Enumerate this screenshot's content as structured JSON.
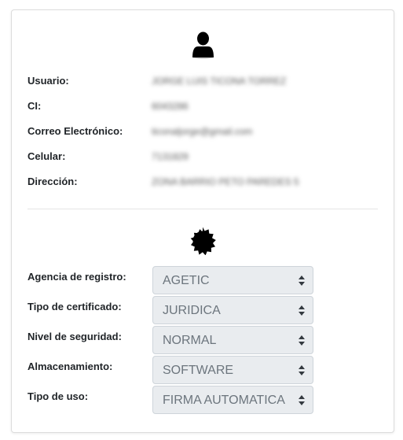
{
  "user_section": {
    "icon": "user-icon",
    "fields": [
      {
        "label": "Usuario:",
        "value": "JORGE LUIS TICONA TORREZ"
      },
      {
        "label": "CI:",
        "value": "6043286"
      },
      {
        "label": "Correo Electrónico:",
        "value": "ticonaljorge@gmail.com"
      },
      {
        "label": "Celular:",
        "value": "7131829"
      },
      {
        "label": "Dirección:",
        "value": "ZONA BARRIO PETO PAREDES 5"
      }
    ]
  },
  "certificate_section": {
    "icon": "certificate-seal-icon",
    "fields": [
      {
        "label": "Agencia de registro:",
        "value": "AGETIC"
      },
      {
        "label": "Tipo de certificado:",
        "value": "JURIDICA"
      },
      {
        "label": "Nivel de seguridad:",
        "value": "NORMAL"
      },
      {
        "label": "Almacenamiento:",
        "value": "SOFTWARE"
      },
      {
        "label": "Tipo de uso:",
        "value": "FIRMA AUTOMATICA"
      }
    ]
  },
  "colors": {
    "select_background": "#e9ecef",
    "select_border": "#ced4da",
    "select_text": "#6c757d",
    "label_text": "#212529",
    "icon": "#000000"
  }
}
